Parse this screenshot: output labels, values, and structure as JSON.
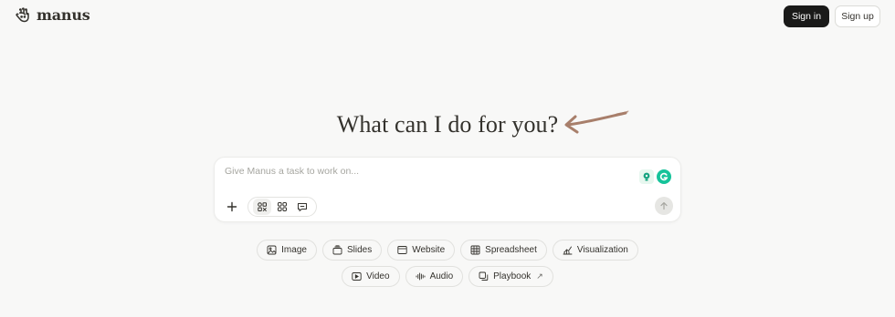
{
  "header": {
    "brand": "manus",
    "signin_label": "Sign in",
    "signup_label": "Sign up"
  },
  "hero": {
    "headline": "What can I do for you?"
  },
  "composer": {
    "placeholder": "Give Manus a task to work on...",
    "value": ""
  },
  "chips_row1": [
    {
      "label": "Image",
      "icon": "image-icon"
    },
    {
      "label": "Slides",
      "icon": "slides-icon"
    },
    {
      "label": "Website",
      "icon": "website-icon"
    },
    {
      "label": "Spreadsheet",
      "icon": "spreadsheet-icon"
    },
    {
      "label": "Visualization",
      "icon": "visualization-icon"
    }
  ],
  "chips_row2": [
    {
      "label": "Video",
      "icon": "video-icon"
    },
    {
      "label": "Audio",
      "icon": "audio-icon"
    },
    {
      "label": "Playbook",
      "icon": "playbook-icon",
      "trailing": "↗"
    }
  ],
  "colors": {
    "background": "#f8f8f7",
    "text": "#34322d",
    "primary_button": "#1a1a19",
    "arrow": "#a87f6b",
    "grammarly": "#15c39a"
  }
}
